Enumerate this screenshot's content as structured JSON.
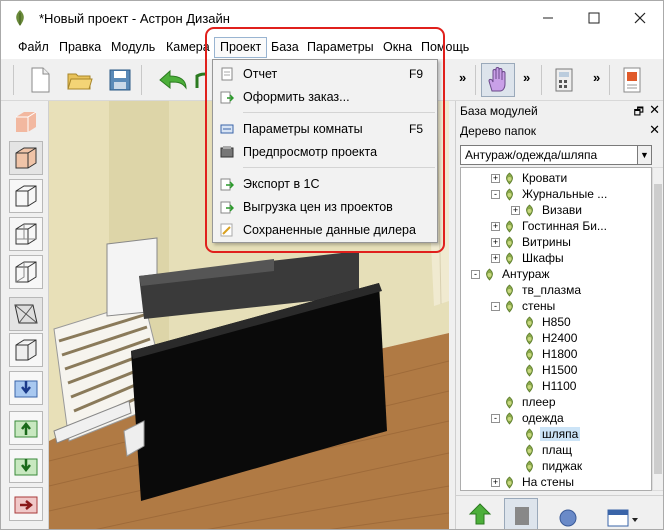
{
  "window": {
    "title": "*Новый проект - Астрон Дизайн",
    "minimize_icon": "minimize-icon",
    "maximize_icon": "maximize-icon",
    "close_icon": "close-icon"
  },
  "menubar": {
    "items": [
      "Файл",
      "Правка",
      "Модуль",
      "Камера",
      "Проект",
      "База",
      "Параметры",
      "Окна",
      "Помощь"
    ],
    "active": "Проект"
  },
  "toolbar": {
    "more1": "»",
    "more2": "»",
    "more3": "»"
  },
  "project_menu": {
    "items": [
      {
        "label": "Отчет",
        "shortcut": "F9",
        "icon": "report-icon"
      },
      {
        "label": "Оформить заказ...",
        "shortcut": "",
        "icon": "order-icon"
      },
      {
        "label": "Параметры комнаты",
        "shortcut": "F5",
        "icon": "room-params-icon"
      },
      {
        "label": "Предпросмотр проекта",
        "shortcut": "",
        "icon": "preview-icon"
      },
      {
        "label": "Экспорт в 1С",
        "shortcut": "",
        "icon": "export-icon"
      },
      {
        "label": "Выгрузка цен из проектов",
        "shortcut": "",
        "icon": "price-export-icon"
      },
      {
        "label": "Сохраненные данные дилера",
        "shortcut": "",
        "icon": "dealer-data-icon"
      }
    ]
  },
  "right_panel": {
    "modules_title": "База модулей",
    "folders_title": "Дерево папок",
    "path": "Антураж/одежда/шляпа",
    "tree": [
      {
        "label": "Кровати",
        "level": 2,
        "expander": "+"
      },
      {
        "label": "Журнальные ...",
        "level": 2,
        "expander": "-"
      },
      {
        "label": "Визави",
        "level": 3,
        "expander": "+"
      },
      {
        "label": "Гостинная Би...",
        "level": 2,
        "expander": "+"
      },
      {
        "label": "Витрины",
        "level": 2,
        "expander": "+"
      },
      {
        "label": "Шкафы",
        "level": 2,
        "expander": "+"
      },
      {
        "label": "Антураж",
        "level": 1,
        "expander": "-"
      },
      {
        "label": "тв_плазма",
        "level": 2,
        "expander": ""
      },
      {
        "label": "стены",
        "level": 2,
        "expander": "-"
      },
      {
        "label": "Н850",
        "level": 3,
        "expander": ""
      },
      {
        "label": "Н2400",
        "level": 3,
        "expander": ""
      },
      {
        "label": "Н1800",
        "level": 3,
        "expander": ""
      },
      {
        "label": "Н1500",
        "level": 3,
        "expander": ""
      },
      {
        "label": "Н1100",
        "level": 3,
        "expander": ""
      },
      {
        "label": "плеер",
        "level": 2,
        "expander": ""
      },
      {
        "label": "одежда",
        "level": 2,
        "expander": "-"
      },
      {
        "label": "шляпа",
        "level": 3,
        "expander": "",
        "selected": true
      },
      {
        "label": "плащ",
        "level": 3,
        "expander": ""
      },
      {
        "label": "пиджак",
        "level": 3,
        "expander": ""
      },
      {
        "label": "На стены",
        "level": 2,
        "expander": "+"
      }
    ]
  },
  "colors": {
    "highlight": "#e0201c",
    "selection": "#cce4f7",
    "wall": "#e6dfb8",
    "floor": "#b07a44"
  }
}
